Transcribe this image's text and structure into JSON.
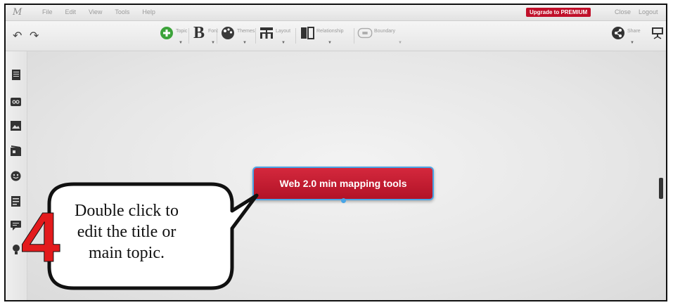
{
  "menubar": {
    "logo": "M",
    "items": [
      "File",
      "Edit",
      "View",
      "Tools",
      "Help"
    ],
    "upgrade_label": "Upgrade to PREMIUM",
    "close_label": "Close",
    "logout_label": "Logout"
  },
  "toolbar": {
    "topic_label": "Topic",
    "font_label": "Font",
    "themes_label": "Themes",
    "layout_label": "Layout",
    "relationship_label": "Relationship",
    "boundary_label": "Boundary",
    "share_label": "Share"
  },
  "sidebar": {
    "icons": [
      "notes-icon",
      "link-icon",
      "image-icon",
      "video-icon",
      "emoji-icon",
      "task-icon",
      "comment-icon",
      "idea-icon"
    ]
  },
  "canvas": {
    "main_topic": "Web 2.0 min mapping tools"
  },
  "annotation": {
    "step_number": "4",
    "text_line1": "Double click to",
    "text_line2": "edit the title or",
    "text_line3": "main topic."
  },
  "colors": {
    "node_fill": "#c01a2e",
    "node_border": "#48a5e6",
    "upgrade_button": "#c0102a",
    "step_number": "#e31a1c"
  }
}
